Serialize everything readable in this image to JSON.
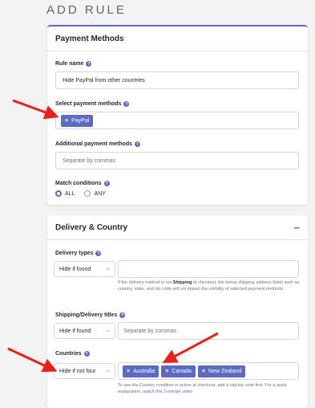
{
  "page": {
    "title": "ADD RULE"
  },
  "payment": {
    "title": "Payment Methods",
    "rule_name_label": "Rule name",
    "rule_name_value": "Hide PayPal from other countries",
    "select_label": "Select payment methods",
    "selected_methods": [
      {
        "label": "PayPal"
      }
    ],
    "additional_label": "Additional payment methods",
    "additional_placeholder": "Separate by commas",
    "match_label": "Match conditions",
    "match_options": [
      {
        "label": "ALL",
        "selected": true
      },
      {
        "label": "ANY",
        "selected": false
      }
    ]
  },
  "delivery": {
    "title": "Delivery & Country",
    "collapse_label": "−",
    "types_label": "Delivery types",
    "types_operator": "Hide if found",
    "types_hint": {
      "before": "If the delivery method is not ",
      "bold": "Shipping",
      "after": " at checkout, the below shipping address fields such as country, state, and zip code will not impact the visibility of selected payment methods."
    },
    "titles_label": "Shipping/Delivery titles",
    "titles_operator": "Hide if found",
    "titles_placeholder": "Separate by commas",
    "countries_label": "Countries",
    "countries_operator": "Hide if not four",
    "countries": [
      {
        "label": "Australia"
      },
      {
        "label": "Canada"
      },
      {
        "label": "New Zealand"
      }
    ],
    "countries_hint": {
      "text": "To see the Country condition in action at checkout, add a city/zip code first. For a quick explanation, ",
      "link": "watch this 2-minute video"
    }
  },
  "colors": {
    "accent": "#5c6ac4",
    "annotation": "#e8201a",
    "background": "#f3f3f4"
  }
}
